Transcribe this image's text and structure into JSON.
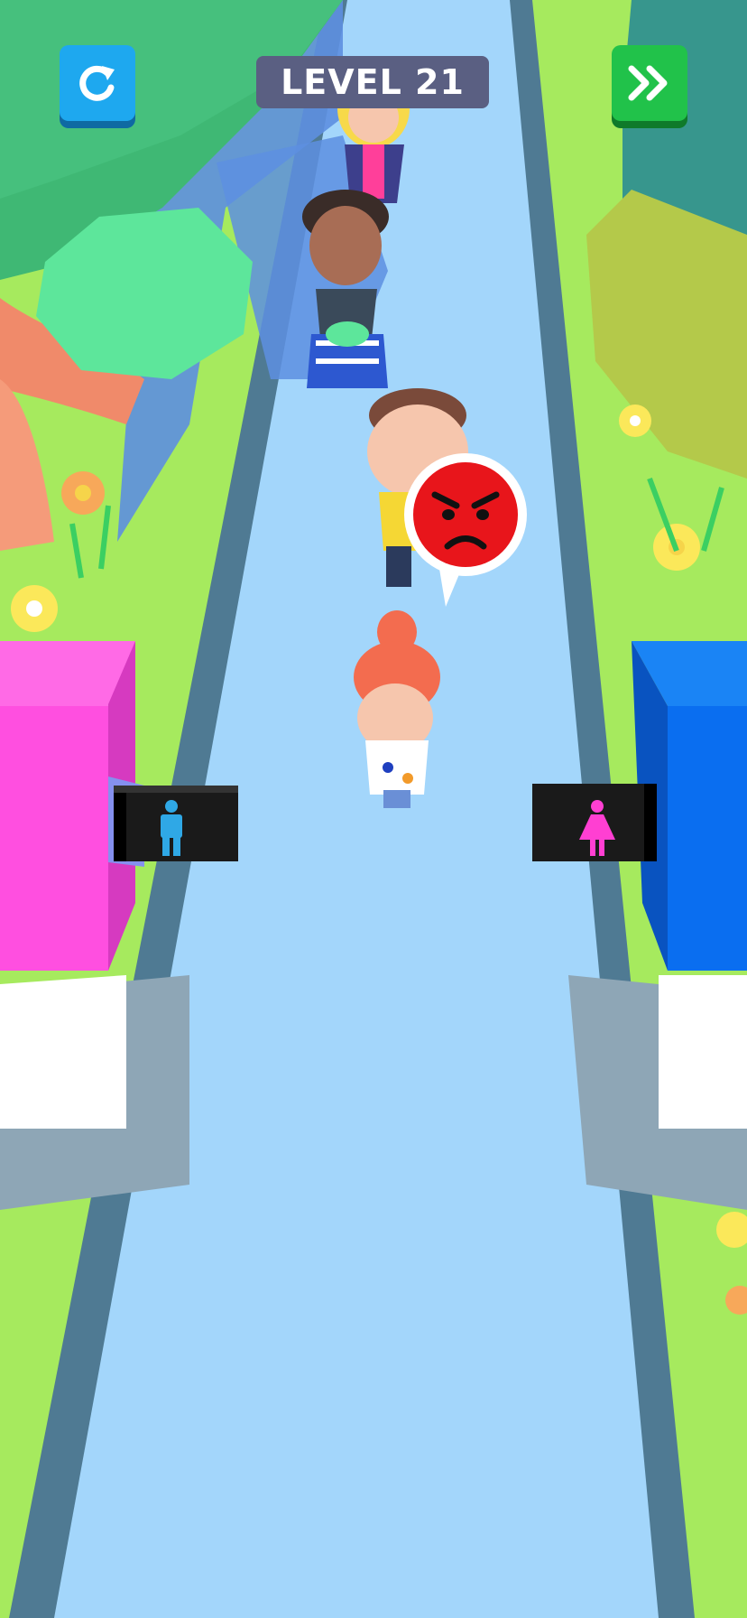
{
  "hud": {
    "level_label": "LEVEL 21",
    "restart_icon": "restart-icon",
    "skip_icon": "fast-forward-icon"
  },
  "scene": {
    "signs": [
      {
        "name": "male-restroom-sign",
        "icon": "male-figure-icon",
        "color": "#2fa8e6"
      },
      {
        "name": "female-restroom-sign",
        "icon": "female-figure-icon",
        "color": "#ff3fd2"
      }
    ],
    "emotion_bubble_icon": "angry-face-icon",
    "colors": {
      "path": "#a3d6fb",
      "grass": "#9fe85a",
      "pink_booth": "#ff4fe0",
      "blue_booth": "#0a6ef0",
      "hud_blue": "#1ea8ef",
      "hud_green": "#21c24a",
      "angry_red": "#e8151b"
    }
  }
}
